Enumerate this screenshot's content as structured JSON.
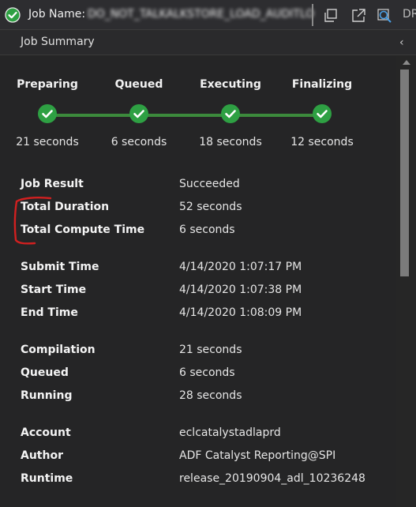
{
  "titlebar": {
    "job_label": "Job Name:",
    "job_name": "DO_NOT_TALKALKSTORE_LOAD_AUDITLO",
    "truncated_label": "DR",
    "status_icon": "check-circle-icon",
    "buttons": [
      "copy-icon",
      "open-external-icon",
      "search-icon"
    ]
  },
  "header": {
    "title": "Job Summary",
    "collapse_icon": "chevron-left-icon"
  },
  "steps": [
    {
      "name": "Preparing",
      "duration": "21 seconds"
    },
    {
      "name": "Queued",
      "duration": "6 seconds"
    },
    {
      "name": "Executing",
      "duration": "18 seconds"
    },
    {
      "name": "Finalizing",
      "duration": "12 seconds"
    }
  ],
  "summary": {
    "job_result": {
      "label": "Job Result",
      "value": "Succeeded"
    },
    "total_duration": {
      "label": "Total Duration",
      "value": "52 seconds"
    },
    "total_compute": {
      "label": "Total Compute Time",
      "value": "6 seconds"
    },
    "submit_time": {
      "label": "Submit Time",
      "value": "4/14/2020 1:07:17 PM"
    },
    "start_time": {
      "label": "Start Time",
      "value": "4/14/2020 1:07:38 PM"
    },
    "end_time": {
      "label": "End Time",
      "value": "4/14/2020 1:08:09 PM"
    },
    "compilation": {
      "label": "Compilation",
      "value": "21 seconds"
    },
    "queued": {
      "label": "Queued",
      "value": "6 seconds"
    },
    "running": {
      "label": "Running",
      "value": "28 seconds"
    },
    "account": {
      "label": "Account",
      "value": "eclcatalystadlaprd"
    },
    "author": {
      "label": "Author",
      "value": "ADF Catalyst Reporting@SPI"
    },
    "runtime": {
      "label": "Runtime",
      "value": "release_20190904_adl_10236248"
    }
  },
  "colors": {
    "success": "#2ea043",
    "progress_line": "#3c8a3c",
    "annotation": "#d12020"
  }
}
